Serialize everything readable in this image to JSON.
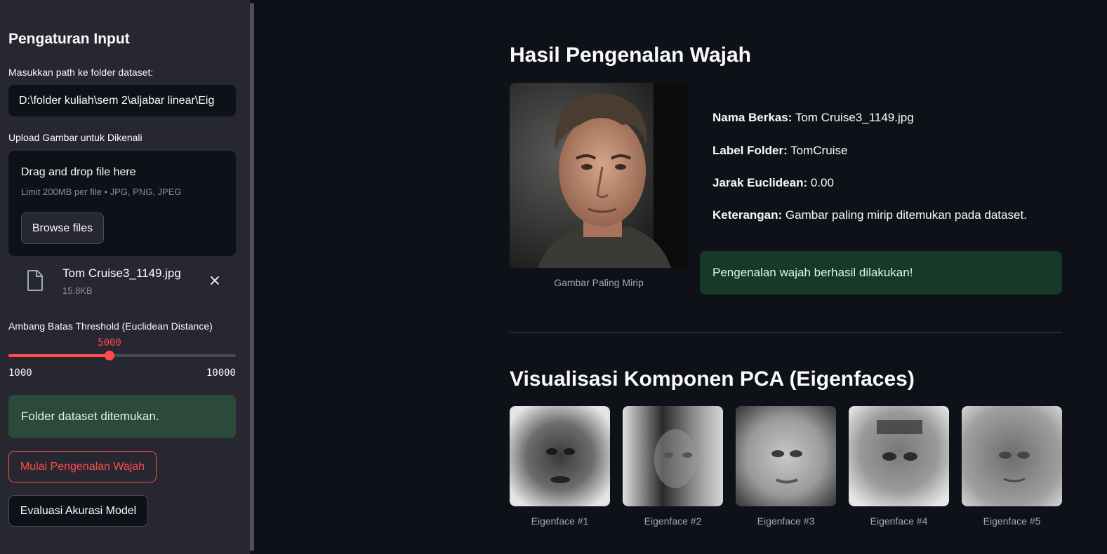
{
  "sidebar": {
    "heading": "Pengaturan Input",
    "dataset_label": "Masukkan path ke folder dataset:",
    "dataset_value": "D:\\folder kuliah\\sem 2\\aljabar linear\\Eig",
    "upload_label": "Upload Gambar untuk Dikenali",
    "dropzone": {
      "title": "Drag and drop file here",
      "subtitle": "Limit 200MB per file • JPG, PNG, JPEG",
      "browse_label": "Browse files"
    },
    "uploaded_file": {
      "name": "Tom Cruise3_1149.jpg",
      "size": "15.8KB"
    },
    "slider": {
      "label": "Ambang Batas Threshold (Euclidean Distance)",
      "value": 5000,
      "value_text": "5000",
      "min": 1000,
      "max": 10000,
      "min_text": "1000",
      "max_text": "10000"
    },
    "alert": "Folder dataset ditemukan.",
    "start_button": "Mulai Pengenalan Wajah",
    "evaluate_button": "Evaluasi Akurasi Model"
  },
  "result": {
    "title": "Hasil Pengenalan Wajah",
    "photo_caption": "Gambar Paling Mirip",
    "fields": [
      {
        "key": "Nama Berkas:",
        "value": "Tom Cruise3_1149.jpg"
      },
      {
        "key": "Label Folder:",
        "value": "TomCruise"
      },
      {
        "key": "Jarak Euclidean:",
        "value": "0.00"
      },
      {
        "key": "Keterangan:",
        "value": "Gambar paling mirip ditemukan pada dataset."
      }
    ],
    "success_message": "Pengenalan wajah berhasil dilakukan!"
  },
  "eigenfaces": {
    "title": "Visualisasi Komponen PCA (Eigenfaces)",
    "items": [
      {
        "caption": "Eigenface #1"
      },
      {
        "caption": "Eigenface #2"
      },
      {
        "caption": "Eigenface #3"
      },
      {
        "caption": "Eigenface #4"
      },
      {
        "caption": "Eigenface #5"
      }
    ]
  },
  "colors": {
    "accent": "#ff4b4b",
    "background": "#0e1117",
    "sidebar": "#262730",
    "success": "#173928"
  }
}
